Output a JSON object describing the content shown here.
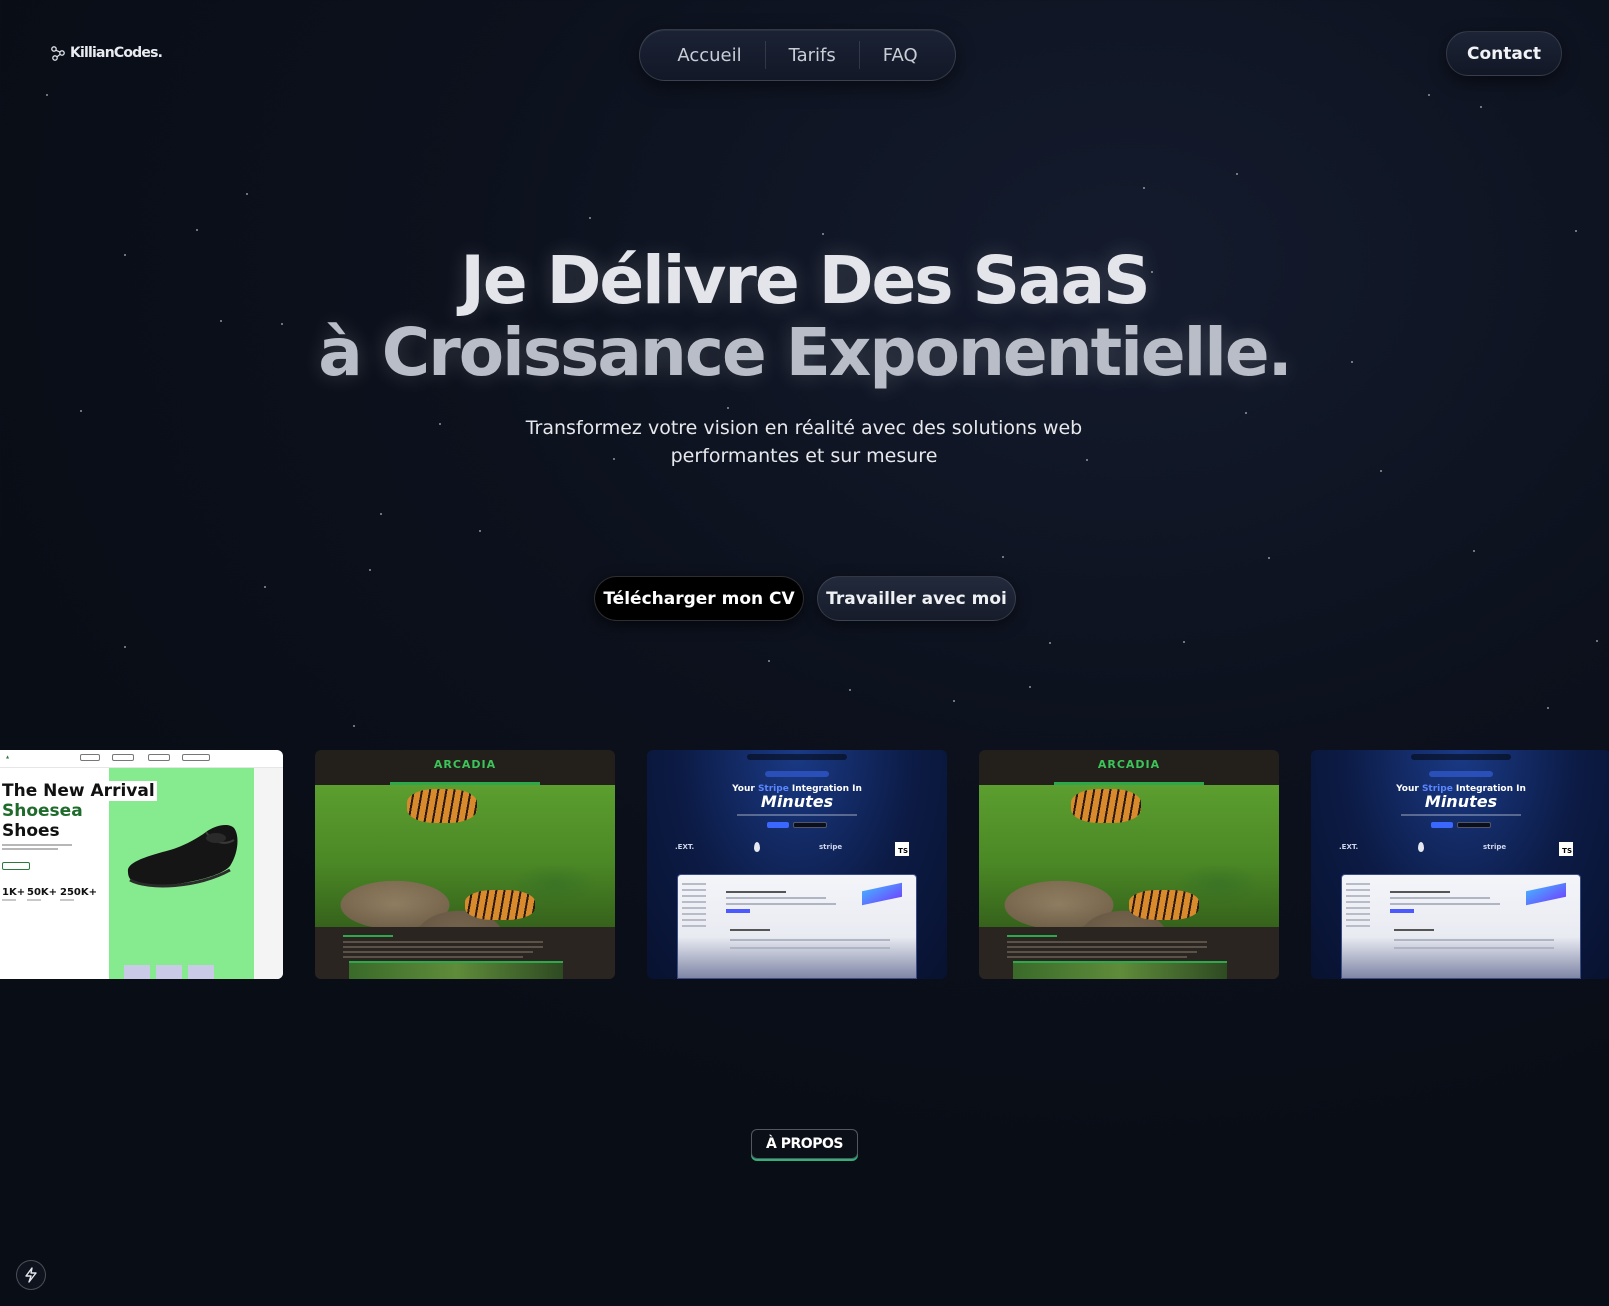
{
  "header": {
    "logo_text": "KillianCodes.",
    "nav": [
      "Accueil",
      "Tarifs",
      "FAQ"
    ],
    "contact_label": "Contact"
  },
  "hero": {
    "title_line1": "Je Délivre Des SaaS",
    "title_line2": "à Croissance Exponentielle.",
    "subtitle": "Transformez votre vision en réalité avec des solutions web performantes et sur mesure",
    "cta_primary": "Télécharger mon CV",
    "cta_secondary": "Travailler avec moi"
  },
  "gallery": {
    "shoes": {
      "title_line1": "The New Arrival",
      "title_line2": "Shoesea",
      "title_line3": "Shoes",
      "stats": [
        "1K+",
        "50K+",
        "250K+"
      ]
    },
    "arcadia": {
      "title": "ARCADIA"
    },
    "stripe": {
      "headline_prefix": "Your ",
      "headline_brand": "Stripe",
      "headline_suffix": " Integration In",
      "headline_big": "Minutes",
      "logo_next": ".EXT.",
      "logo_stripe": "stripe",
      "logo_ts": "TS"
    }
  },
  "section_badge": "À PROPOS",
  "icons": {
    "logo": "nodes-icon",
    "bottom_button": "bolt-icon"
  }
}
